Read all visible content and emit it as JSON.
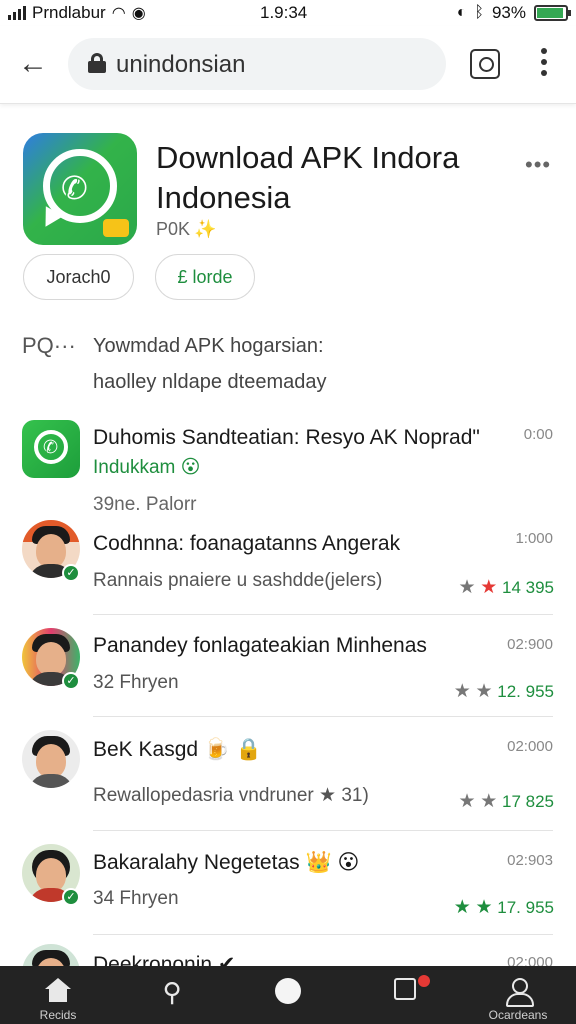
{
  "status_bar": {
    "carrier": "Prndlabur",
    "time": "1.9:34",
    "battery_percent": "93%",
    "battery_level": 0.93,
    "icons": [
      "signal-icon",
      "wifi-icon",
      "alarm-icon",
      "bluetooth-icon",
      "battery-icon"
    ]
  },
  "browser": {
    "url": "unindonsian",
    "icons": [
      "back-arrow-icon",
      "lock-icon",
      "tabs-icon",
      "more-vert-icon"
    ]
  },
  "app": {
    "title": "Download APK Indora Indonesia",
    "subtitle": "P0K",
    "subtitle_emoji": "✨",
    "more_label": "•••",
    "button_1": "Jorach0",
    "button_2": "£ lorde",
    "colors": {
      "accent": "#1e8e3e",
      "icon_blue": "#2f7de0",
      "icon_green": "#33b34a"
    }
  },
  "section": {
    "tag": "PQ···",
    "line1": "Yowmdad APK hogarsian:",
    "line2": "haolley nldape dteemaday"
  },
  "list": [
    {
      "title": "Duhomis Sandteatian: Resyo AK Noprad\"",
      "subtitle": "Indukkam 😮",
      "meta": "39ne. Palorr",
      "time": "0:00",
      "rating": ""
    },
    {
      "title": "Codhnna: foanagatanns Angerak",
      "subtitle": "Rannais pnaiere u sashdde(jelers)",
      "meta": "",
      "time": "1:000",
      "rating": "14 395"
    },
    {
      "title": "Panandey fonlagateakian Minhenas",
      "subtitle": "32 Fhryen",
      "meta": "",
      "time": "02:900",
      "rating": "12. 955"
    },
    {
      "title": "BeK Kasgd 🍺 🔒",
      "subtitle": "Rewallopedasria vndruner ★ 31)",
      "meta": "",
      "time": "02:000",
      "rating": "17 825"
    },
    {
      "title": "Bakaralahy Negetetas 👑 😮",
      "subtitle": "34 Fhryen",
      "meta": "",
      "time": "02:903",
      "rating": "17. 955"
    },
    {
      "title": "Deekrononin ✔",
      "subtitle": "",
      "meta": "",
      "time": "02:000",
      "rating": ""
    }
  ],
  "bottom_nav": {
    "home_label": "Recids",
    "profile_label": "Ocardeans"
  }
}
